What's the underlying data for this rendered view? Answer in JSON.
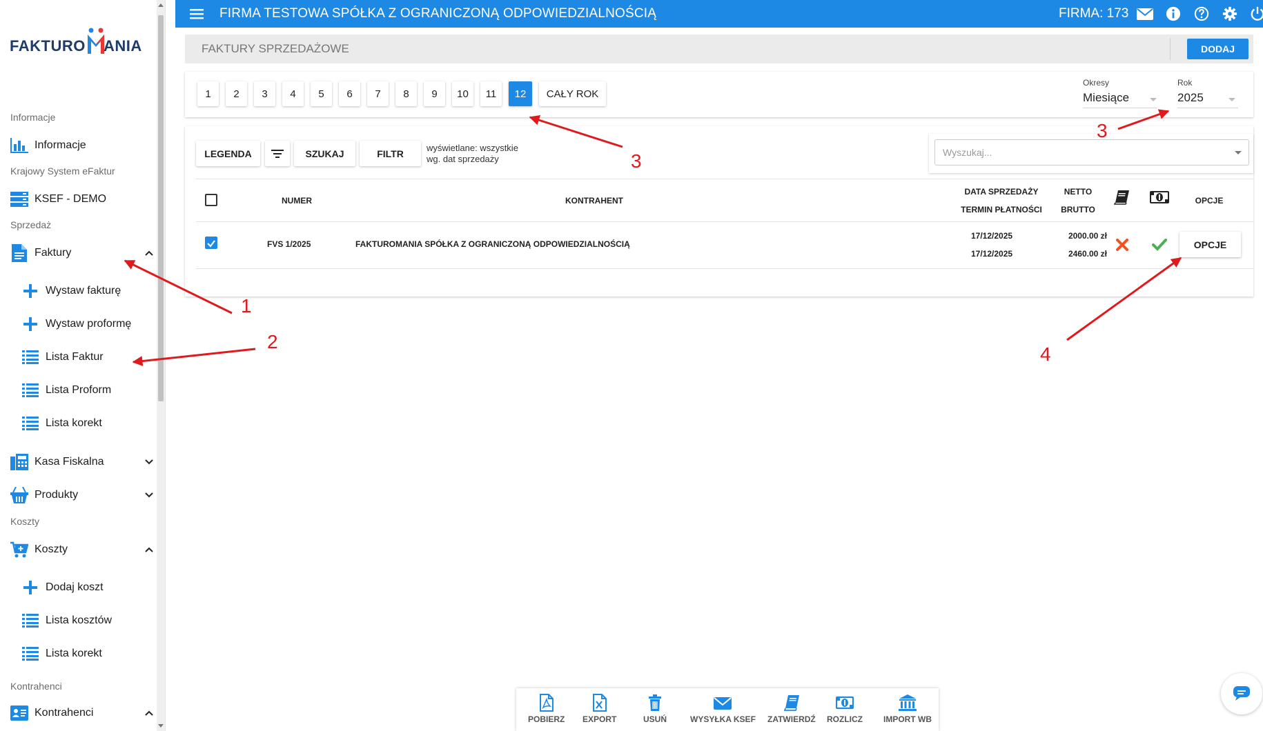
{
  "app": {
    "company_title": "FIRMA TESTOWA SPÓŁKA Z OGRANICZONĄ ODPOWIEDZIALNOŚCIĄ",
    "firma_label": "FIRMA: 173",
    "accent_color": "#1e88e5"
  },
  "logo": {
    "text_left": "FAKTURO",
    "text_right": "ANIA"
  },
  "sidebar": {
    "sections": [
      {
        "label": "Informacje"
      },
      {
        "label": "Krajowy System eFaktur"
      },
      {
        "label": "Sprzedaż"
      },
      {
        "label": "Koszty"
      },
      {
        "label": "Kontrahenci"
      }
    ],
    "items": [
      {
        "label": "Informacje",
        "icon": "chart-icon"
      },
      {
        "label": "KSEF - DEMO",
        "icon": "server-icon"
      },
      {
        "label": "Faktury",
        "icon": "document-icon",
        "expanded": true
      },
      {
        "label": "Kasa Fiskalna",
        "icon": "cash-register-icon",
        "expanded": false
      },
      {
        "label": "Produkty",
        "icon": "basket-icon",
        "expanded": false
      },
      {
        "label": "Koszty",
        "icon": "cart-icon",
        "expanded": true
      },
      {
        "label": "Kontrahenci",
        "icon": "contact-card-icon",
        "expanded": true
      }
    ],
    "faktury_sub": [
      {
        "label": "Wystaw fakturę",
        "icon": "plus-icon"
      },
      {
        "label": "Wystaw proformę",
        "icon": "plus-icon"
      },
      {
        "label": "Lista Faktur",
        "icon": "list-icon"
      },
      {
        "label": "Lista Proform",
        "icon": "list-icon"
      },
      {
        "label": "Lista korekt",
        "icon": "list-icon"
      }
    ],
    "koszty_sub": [
      {
        "label": "Dodaj koszt",
        "icon": "plus-icon"
      },
      {
        "label": "Lista kosztów",
        "icon": "list-icon"
      },
      {
        "label": "Lista korekt",
        "icon": "list-icon"
      }
    ]
  },
  "header": {
    "title": "FAKTURY SPRZEDAŻOWE",
    "add_label": "DODAJ"
  },
  "periods": {
    "months": [
      "1",
      "2",
      "3",
      "4",
      "5",
      "6",
      "7",
      "8",
      "9",
      "10",
      "11",
      "12"
    ],
    "active": "12",
    "whole_year": "CAŁY ROK",
    "okresy_label": "Okresy",
    "okresy_value": "Miesiące",
    "rok_label": "Rok",
    "rok_value": "2025"
  },
  "toolbar": {
    "legend": "LEGENDA",
    "search": "SZUKAJ",
    "filter": "FILTR",
    "info_line1": "wyświetlane: wszystkie",
    "info_line2": "wg. dat sprzedaży",
    "search_placeholder": "Wyszukaj..."
  },
  "table": {
    "headers": {
      "numer": "NUMER",
      "kontrahent": "KONTRAHENT",
      "data_sprzedazy": "DATA SPRZEDAŻY",
      "termin_platnosci": "TERMIN PŁATNOŚCI",
      "netto": "NETTO",
      "brutto": "BRUTTO",
      "opcje": "OPCJE"
    },
    "rows": [
      {
        "checked": true,
        "numer": "FVS 1/2025",
        "kontrahent": "FAKTUROMANIA SPÓŁKA Z OGRANICZONĄ ODPOWIEDZIALNOŚCIĄ",
        "data_sprzedazy": "17/12/2025",
        "termin_platnosci": "17/12/2025",
        "netto": "2000.00 zł",
        "brutto": "2460.00 zł",
        "booked": false,
        "paid": true,
        "opcje_label": "OPCJE"
      }
    ]
  },
  "annotations": [
    "1",
    "2",
    "3",
    "3",
    "4"
  ],
  "bottom_toolbar": [
    {
      "label": "POBIERZ",
      "icon": "pdf-icon"
    },
    {
      "label": "EXPORT",
      "icon": "excel-icon"
    },
    {
      "label": "USUŃ",
      "icon": "trash-icon"
    },
    {
      "label": "WYSYŁKA KSEF",
      "icon": "envelope-icon"
    },
    {
      "label": "ZATWIERDŹ",
      "icon": "book-icon"
    },
    {
      "label": "ROZLICZ",
      "icon": "money-icon"
    },
    {
      "label": "IMPORT WB",
      "icon": "bank-icon"
    }
  ]
}
